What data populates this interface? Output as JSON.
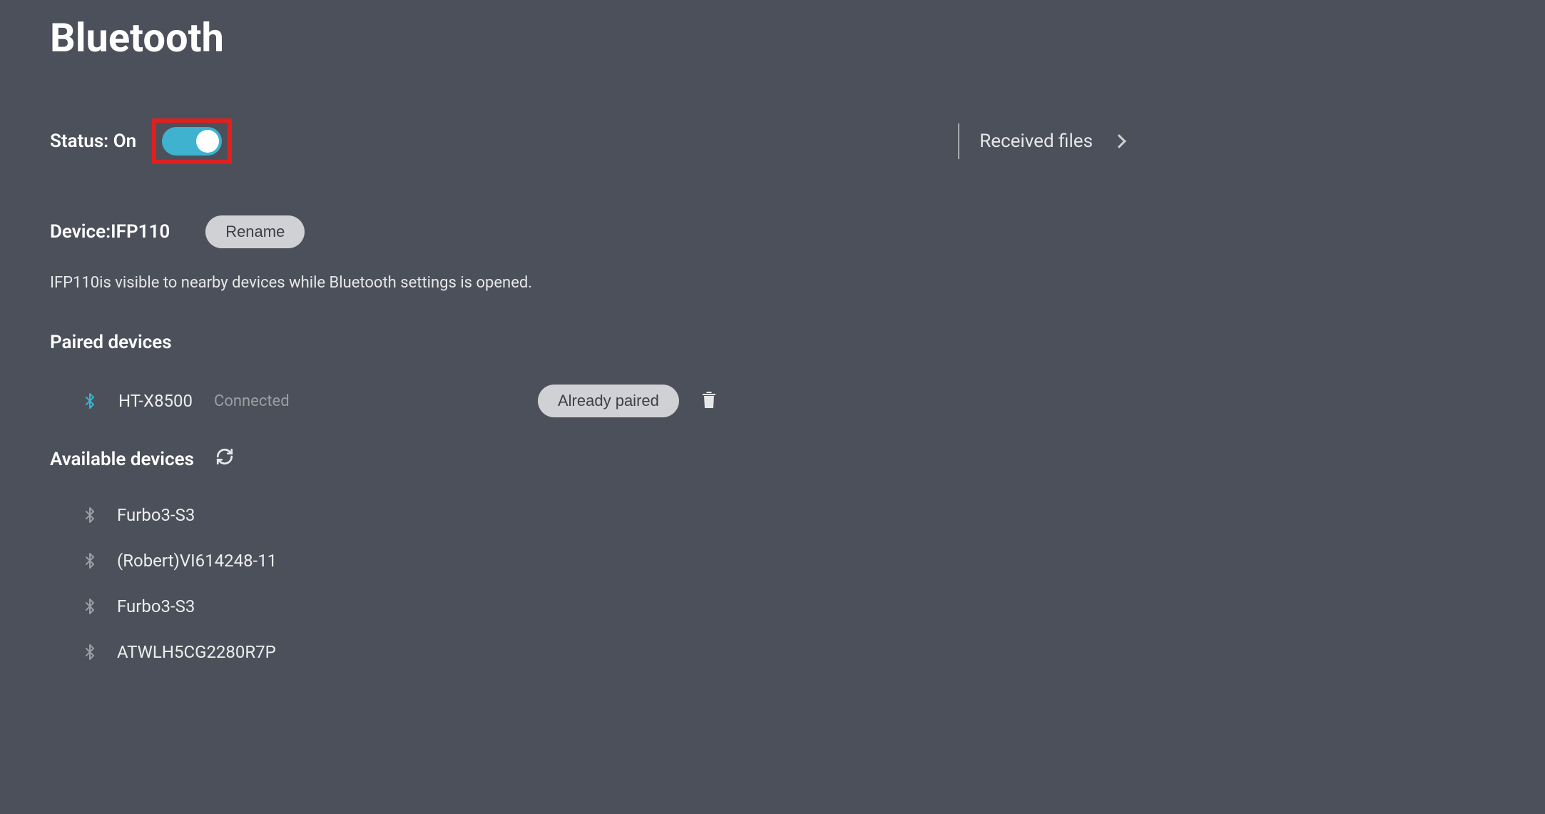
{
  "title": "Bluetooth",
  "status": {
    "label": "Status: On"
  },
  "received_files": {
    "label": "Received files"
  },
  "device": {
    "label": "Device:IFP110",
    "rename_button": "Rename",
    "visibility_text": "IFP110is visible to nearby devices while Bluetooth settings is opened."
  },
  "paired": {
    "header": "Paired devices",
    "items": [
      {
        "name": "HT-X8500",
        "status": "Connected",
        "button_label": "Already paired"
      }
    ]
  },
  "available": {
    "header": "Available devices",
    "items": [
      {
        "name": "Furbo3-S3"
      },
      {
        "name": "(Robert)VI614248-11"
      },
      {
        "name": "Furbo3-S3"
      },
      {
        "name": "ATWLH5CG2280R7P"
      }
    ]
  }
}
